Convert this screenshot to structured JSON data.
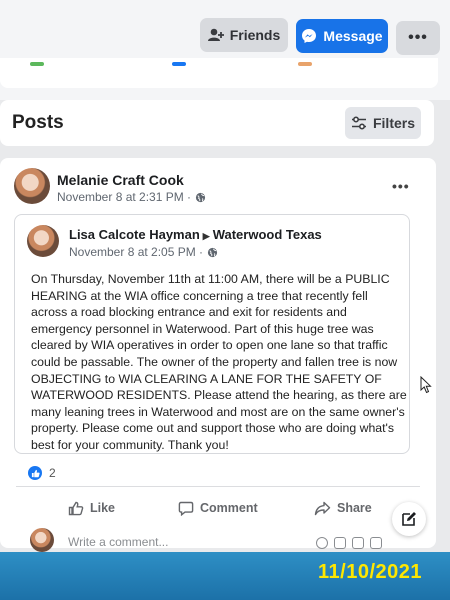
{
  "header": {
    "friends_label": "Friends",
    "message_label": "Message",
    "more_label": "•••"
  },
  "posts_section": {
    "title": "Posts",
    "filters_label": "Filters"
  },
  "post": {
    "author": "Melanie Craft Cook",
    "timestamp": "November 8 at 2:31 PM ·",
    "menu_label": "•••",
    "shared_post": {
      "author": "Lisa Calcote Hayman",
      "target": "Waterwood Texas",
      "timestamp": "November 8 at 2:05 PM ·",
      "body": "On Thursday, November 11th at 11:00 AM, there will be a PUBLIC HEARING at the WIA office concerning a tree that recently fell across a road blocking entrance and exit for residents and emergency personnel in Waterwood.  Part of this huge tree was cleared by WIA operatives in order to open one lane so that traffic could be passable.  The owner of the property and fallen tree is now OBJECTING to WIA CLEARING A LANE FOR THE SAFETY OF WATERWOOD RESIDENTS. Please attend the hearing, as there are many leaning trees in Waterwood and most are on the same owner's property.  Please come out and support those who are doing what's best for your community. Thank you!"
    },
    "reaction_count": "2",
    "actions": {
      "like": "Like",
      "comment": "Comment",
      "share": "Share"
    },
    "comment_placeholder": "Write a comment..."
  },
  "photo_date_stamp": "11/10/2021",
  "colors": {
    "brand_blue": "#1873e8",
    "stamp_yellow": "#ffe700"
  },
  "icons": [
    "add-friend-icon",
    "messenger-icon",
    "filters-icon",
    "globe-icon",
    "like-icon",
    "comment-icon",
    "share-icon",
    "compose-icon"
  ]
}
